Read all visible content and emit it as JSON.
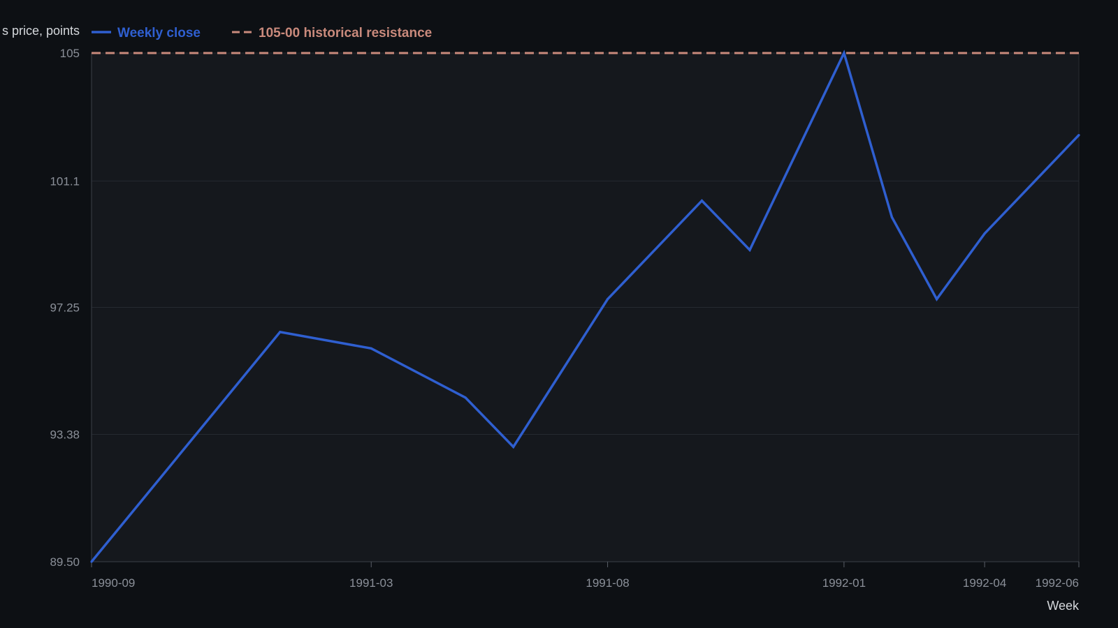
{
  "chart_data": {
    "type": "line",
    "ylabel": "s price, points",
    "xlabel": "Week",
    "ylim": [
      89.5,
      105
    ],
    "y_ticks": [
      "89.50",
      "93.38",
      "97.25",
      "101.1",
      "105"
    ],
    "x_ticks": [
      {
        "date": "1990-09-01",
        "label": "1990-09"
      },
      {
        "date": "1991-03-01",
        "label": "1991-03"
      },
      {
        "date": "1991-08-01",
        "label": "1991-08"
      },
      {
        "date": "1992-01-01",
        "label": "1992-01"
      },
      {
        "date": "1992-04-01",
        "label": "1992-04"
      },
      {
        "date": "1992-06-01",
        "label": "1992-06"
      }
    ],
    "xlim": [
      "1990-09-01",
      "1992-06-01"
    ],
    "grid": true,
    "legend_position": "top-left",
    "series": [
      {
        "name": "Weekly close",
        "color": "#2f5fd0",
        "points": [
          {
            "x": "1990-09-01",
            "y": 89.5
          },
          {
            "x": "1991-01-01",
            "y": 96.5
          },
          {
            "x": "1991-03-01",
            "y": 96.0
          },
          {
            "x": "1991-05-01",
            "y": 94.5
          },
          {
            "x": "1991-06-01",
            "y": 93.0
          },
          {
            "x": "1991-08-01",
            "y": 97.5
          },
          {
            "x": "1991-10-01",
            "y": 100.5
          },
          {
            "x": "1991-11-01",
            "y": 99.0
          },
          {
            "x": "1992-01-01",
            "y": 105.0
          },
          {
            "x": "1992-02-01",
            "y": 100.0
          },
          {
            "x": "1992-03-01",
            "y": 97.5
          },
          {
            "x": "1992-04-01",
            "y": 99.5
          },
          {
            "x": "1992-06-01",
            "y": 102.5
          }
        ]
      }
    ],
    "reference_lines": [
      {
        "name": "105-00 historical resistance",
        "y": 105,
        "style": "dashed",
        "color": "#c98a7c"
      }
    ]
  }
}
